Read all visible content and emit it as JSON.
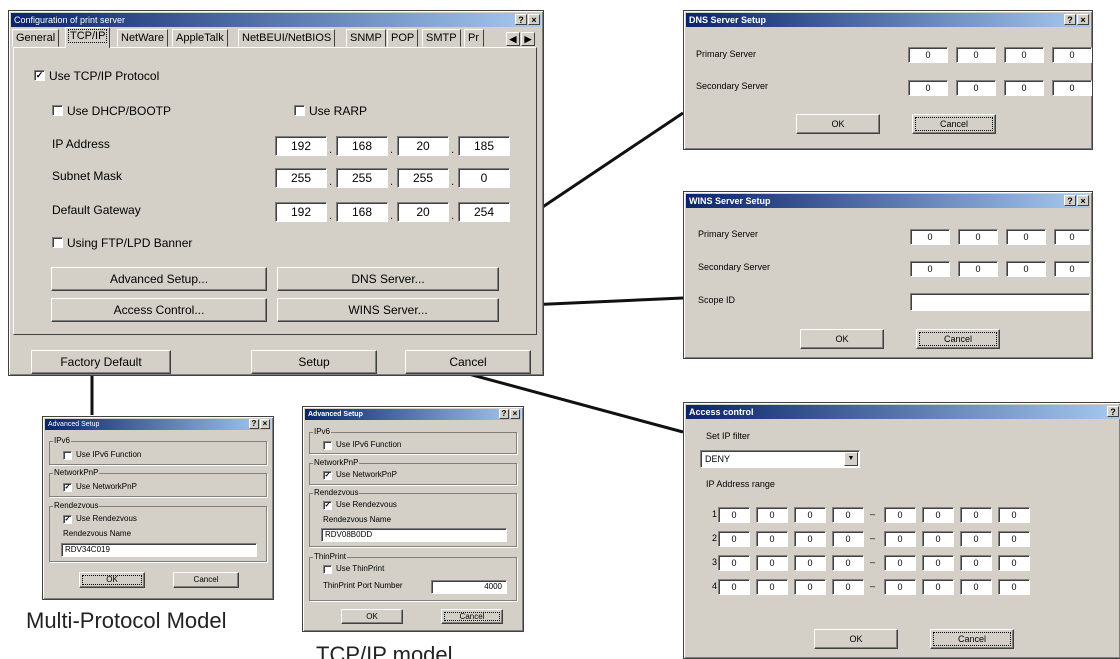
{
  "main": {
    "title": "Configuration of print server",
    "tabs": [
      "General",
      "TCP/IP",
      "NetWare",
      "AppleTalk",
      "NetBEUI/NetBIOS",
      "SNMP",
      "POP",
      "SMTP",
      "Pr"
    ],
    "use_tcpip": "Use TCP/IP Protocol",
    "use_dhcp": "Use DHCP/BOOTP",
    "use_rarp": "Use RARP",
    "ip_label": "IP Address",
    "ip": [
      "192",
      "168",
      "20",
      "185"
    ],
    "subnet_label": "Subnet Mask",
    "subnet": [
      "255",
      "255",
      "255",
      "0"
    ],
    "gateway_label": "Default Gateway",
    "gateway": [
      "192",
      "168",
      "20",
      "254"
    ],
    "ftp_banner": "Using FTP/LPD Banner",
    "advanced_btn": "Advanced Setup...",
    "dns_btn": "DNS Server...",
    "access_btn": "Access Control...",
    "wins_btn": "WINS Server...",
    "factory_btn": "Factory Default",
    "setup_btn": "Setup",
    "cancel_btn": "Cancel"
  },
  "dns": {
    "title": "DNS Server Setup",
    "primary_label": "Primary Server",
    "primary": [
      "0",
      "0",
      "0",
      "0"
    ],
    "secondary_label": "Secondary Server",
    "secondary": [
      "0",
      "0",
      "0",
      "0"
    ],
    "ok": "OK",
    "cancel": "Cancel"
  },
  "wins": {
    "title": "WINS Server Setup",
    "primary_label": "Primary Server",
    "primary": [
      "0",
      "0",
      "0",
      "0"
    ],
    "secondary_label": "Secondary Server",
    "secondary": [
      "0",
      "0",
      "0",
      "0"
    ],
    "scope_label": "Scope ID",
    "scope_value": "",
    "ok": "OK",
    "cancel": "Cancel"
  },
  "access": {
    "title": "Access control",
    "filter_label": "Set IP filter",
    "filter_value": "DENY",
    "range_label": "IP Address range",
    "rows": [
      {
        "n": "1",
        "from": [
          "0",
          "0",
          "0",
          "0"
        ],
        "to": [
          "0",
          "0",
          "0",
          "0"
        ]
      },
      {
        "n": "2",
        "from": [
          "0",
          "0",
          "0",
          "0"
        ],
        "to": [
          "0",
          "0",
          "0",
          "0"
        ]
      },
      {
        "n": "3",
        "from": [
          "0",
          "0",
          "0",
          "0"
        ],
        "to": [
          "0",
          "0",
          "0",
          "0"
        ]
      },
      {
        "n": "4",
        "from": [
          "0",
          "0",
          "0",
          "0"
        ],
        "to": [
          "0",
          "0",
          "0",
          "0"
        ]
      }
    ],
    "dash": "–",
    "ok": "OK",
    "cancel": "Cancel"
  },
  "adv_multi": {
    "title": "Advanced Setup",
    "ipv6_group": "IPv6",
    "use_ipv6": "Use IPv6 Function",
    "npnp_group": "NetworkPnP",
    "use_npnp": "Use NetworkPnP",
    "rv_group": "Rendezvous",
    "use_rv": "Use Rendezvous",
    "rv_name_label": "Rendezvous Name",
    "rv_name": "RDV34C019",
    "ok": "OK",
    "cancel": "Cancel",
    "caption": "Multi-Protocol Model"
  },
  "adv_tcp": {
    "title": "Advanced Setup",
    "ipv6_group": "IPv6",
    "use_ipv6": "Use IPv6 Function",
    "npnp_group": "NetworkPnP",
    "use_npnp": "Use NetworkPnP",
    "rv_group": "Rendezvous",
    "use_rv": "Use Rendezvous",
    "rv_name_label": "Rendezvous Name",
    "rv_name": "RDV08B0DD",
    "tp_group": "ThinPrint",
    "use_tp": "Use ThinPrint",
    "tp_port_label": "ThinPrint Port Number",
    "tp_port": "4000",
    "ok": "OK",
    "cancel": "Cancel",
    "caption": "TCP/IP model"
  },
  "common": {
    "help_glyph": "?",
    "close_glyph": "×",
    "check_glyph": "✓",
    "left_glyph": "◀",
    "right_glyph": "▶",
    "dropdown_glyph": "▼",
    "ip_sep": "."
  }
}
